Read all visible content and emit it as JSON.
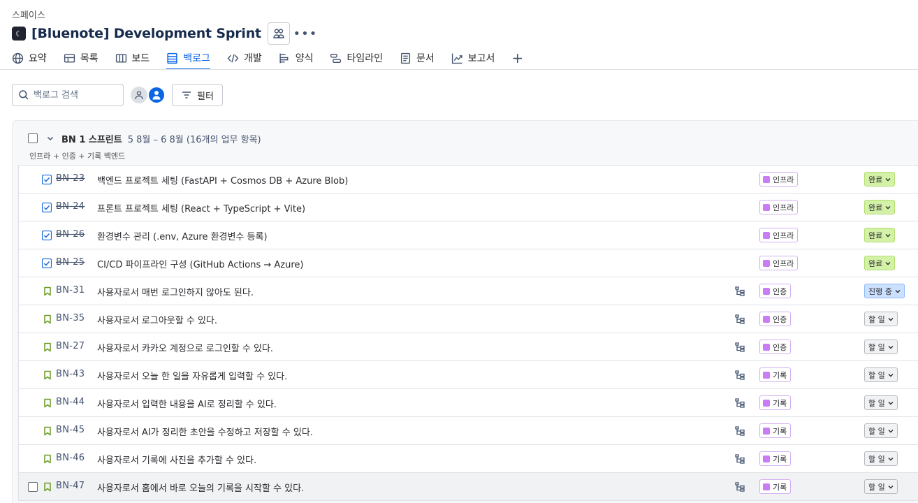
{
  "breadcrumb": "스페이스",
  "header": {
    "title": "[Bluenote] Development Sprint"
  },
  "tabs": [
    {
      "label": "요약",
      "icon": "globe-icon"
    },
    {
      "label": "목록",
      "icon": "list-icon"
    },
    {
      "label": "보드",
      "icon": "board-icon"
    },
    {
      "label": "백로그",
      "icon": "backlog-icon",
      "active": true
    },
    {
      "label": "개발",
      "icon": "code-icon"
    },
    {
      "label": "양식",
      "icon": "form-icon"
    },
    {
      "label": "타임라인",
      "icon": "timeline-icon"
    },
    {
      "label": "문서",
      "icon": "document-icon"
    },
    {
      "label": "보고서",
      "icon": "chart-line-icon"
    }
  ],
  "toolbar": {
    "search_placeholder": "백로그 검색",
    "filter_label": "필터"
  },
  "sprint": {
    "name": "BN 1 스프린트",
    "dates": "5 8월 – 6 8월 (16개의 업무 항목)",
    "goal": "인프라 + 인증 + 기록 백엔드"
  },
  "issues": [
    {
      "key": "BN-23",
      "summary": "백엔드 프로젝트 세팅 (FastAPI + Cosmos DB + Azure Blob)",
      "epic": "인프라",
      "status": "완료",
      "type": "task",
      "done": true
    },
    {
      "key": "BN-24",
      "summary": "프론트 프로젝트 세팅 (React + TypeScript + Vite)",
      "epic": "인프라",
      "status": "완료",
      "type": "task",
      "done": true
    },
    {
      "key": "BN-26",
      "summary": "환경변수 관리 (.env, Azure 환경변수 등록)",
      "epic": "인프라",
      "status": "완료",
      "type": "task",
      "done": true
    },
    {
      "key": "BN-25",
      "summary": "CI/CD 파이프라인 구성 (GitHub Actions → Azure)",
      "epic": "인프라",
      "status": "완료",
      "type": "task",
      "done": true
    },
    {
      "key": "BN-31",
      "summary": "사용자로서 매번 로그인하지 않아도 된다.",
      "epic": "인증",
      "status": "진행 중",
      "type": "story",
      "done": false
    },
    {
      "key": "BN-35",
      "summary": "사용자로서 로그아웃할 수 있다.",
      "epic": "인증",
      "status": "할 일",
      "type": "story",
      "done": false
    },
    {
      "key": "BN-27",
      "summary": "사용자로서 카카오 계정으로 로그인할 수 있다.",
      "epic": "인증",
      "status": "할 일",
      "type": "story",
      "done": false
    },
    {
      "key": "BN-43",
      "summary": "사용자로서 오늘 한 일을 자유롭게 입력할 수 있다.",
      "epic": "기록",
      "status": "할 일",
      "type": "story",
      "done": false
    },
    {
      "key": "BN-44",
      "summary": "사용자로서 입력한 내용을 AI로 정리할 수 있다.",
      "epic": "기록",
      "status": "할 일",
      "type": "story",
      "done": false
    },
    {
      "key": "BN-45",
      "summary": "사용자로서 AI가 정리한 초안을 수정하고 저장할 수 있다.",
      "epic": "기록",
      "status": "할 일",
      "type": "story",
      "done": false
    },
    {
      "key": "BN-46",
      "summary": "사용자로서 기록에 사진을 추가할 수 있다.",
      "epic": "기록",
      "status": "할 일",
      "type": "story",
      "done": false
    },
    {
      "key": "BN-47",
      "summary": "사용자로서 홈에서 바로 오늘의 기록을 시작할 수 있다.",
      "epic": "기록",
      "status": "할 일",
      "type": "story",
      "done": false
    }
  ],
  "colors": {
    "accent": "#0c66e4",
    "epic": "#c97cf4",
    "done": "#d3f1a7",
    "in_progress": "#cce0ff",
    "todo": "#f1f2f4",
    "story": "#6a9a23"
  }
}
